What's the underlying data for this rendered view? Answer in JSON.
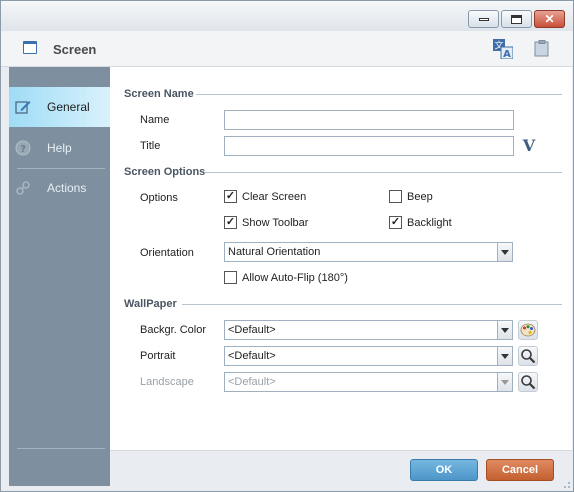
{
  "header": {
    "title": "Screen"
  },
  "sidebar": {
    "items": [
      {
        "label": "General",
        "active": true
      },
      {
        "label": "Help",
        "active": false
      },
      {
        "label": "Actions",
        "active": false
      }
    ]
  },
  "screen_name": {
    "section": "Screen Name",
    "name_label": "Name",
    "name_value": "",
    "title_label": "Title",
    "title_value": ""
  },
  "screen_options": {
    "section": "Screen Options",
    "options_label": "Options",
    "clear_screen": {
      "label": "Clear Screen",
      "checked": true
    },
    "beep": {
      "label": "Beep",
      "checked": false
    },
    "show_toolbar": {
      "label": "Show Toolbar",
      "checked": true
    },
    "backlight": {
      "label": "Backlight",
      "checked": true
    },
    "orientation_label": "Orientation",
    "orientation_value": "Natural Orientation",
    "auto_flip": {
      "label": "Allow Auto-Flip (180°)",
      "checked": false
    }
  },
  "wallpaper": {
    "section": "WallPaper",
    "color_label": "Backgr. Color",
    "color_value": "<Default>",
    "portrait_label": "Portrait",
    "portrait_value": "<Default>",
    "landscape_label": "Landscape",
    "landscape_value": "<Default>"
  },
  "footer": {
    "ok_label": "OK",
    "cancel_label": "Cancel"
  },
  "colors": {
    "accent": "#4e95c8",
    "cancel": "#c4602f",
    "sidebar": "#7e909f",
    "active_tab": "#9fdcf6"
  }
}
